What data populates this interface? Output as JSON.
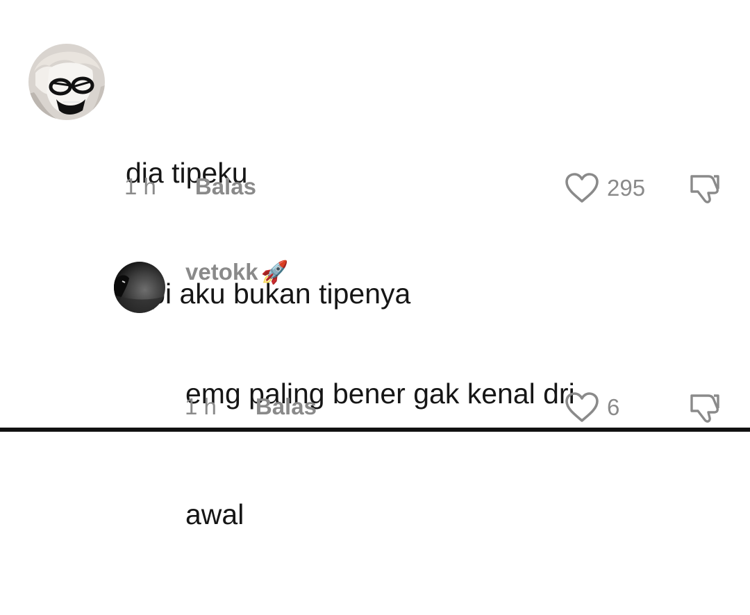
{
  "comments": [
    {
      "avatar_icon": "anime-character-avatar-icon",
      "lines": [
        "dia tipeku",
        "tapi aku bukan tipenya"
      ],
      "time": "1 h",
      "reply_label": "Balas",
      "like_count": "295"
    }
  ],
  "replies": [
    {
      "username": "vetokk",
      "username_emoji": "🚀",
      "avatar_icon": "dark-photo-avatar-icon",
      "lines": [
        "emg paling bener gak kenal dri",
        "awal"
      ],
      "time": "1 h",
      "reply_label": "Balas",
      "like_count": "6"
    }
  ],
  "colors": {
    "text": "#161616",
    "muted": "#8a8a8a",
    "background": "#ffffff"
  }
}
